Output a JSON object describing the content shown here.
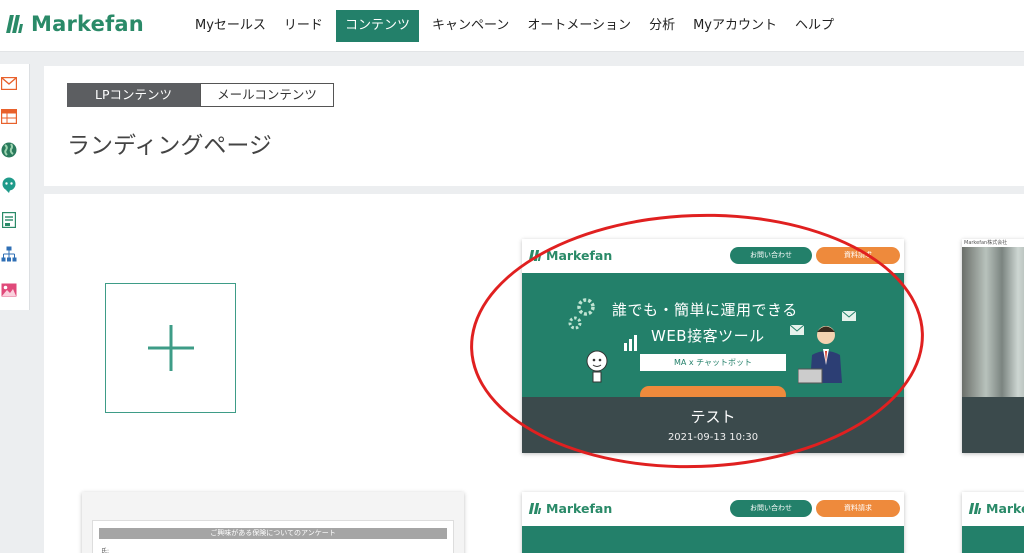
{
  "app": {
    "logo_text": "Markefan",
    "brand_color": "#23806a",
    "accent_orange": "#ee8a3c"
  },
  "nav": {
    "items": [
      {
        "label": "Myセールス",
        "active": false
      },
      {
        "label": "リード",
        "active": false
      },
      {
        "label": "コンテンツ",
        "active": true
      },
      {
        "label": "キャンペーン",
        "active": false
      },
      {
        "label": "オートメーション",
        "active": false
      },
      {
        "label": "分析",
        "active": false
      },
      {
        "label": "Myアカウント",
        "active": false
      },
      {
        "label": "ヘルプ",
        "active": false
      }
    ]
  },
  "rail": {
    "icons": [
      "mail-icon",
      "table-icon",
      "globe-icon",
      "chatbot-icon",
      "form-icon",
      "sitemap-icon",
      "image-icon"
    ]
  },
  "content_tabs": {
    "lp": "LPコンテンツ",
    "mail": "メールコンテンツ",
    "active": "lp"
  },
  "page": {
    "title": "ランディングページ"
  },
  "cards": {
    "add_icon": "plus-icon",
    "featured": {
      "logo_text": "Markefan",
      "btn_contact": "お問い合わせ",
      "btn_docs": "資料請求",
      "hero_line1": "誰でも・簡単に運用できる",
      "hero_line2": "WEB接客ツール",
      "hero_pill": "MA x チャットボット",
      "overlay_title": "テスト",
      "overlay_date": "2021-09-13 10:30"
    },
    "photo_card": {
      "caption": "Markefan株式会社"
    },
    "bottom_left": {
      "survey_title": "ご興味がある保険についてのアンケート",
      "first_label": "氏:"
    },
    "bottom_mid": {
      "logo_text": "Markefan",
      "btn_contact": "お問い合わせ",
      "btn_docs": "資料請求"
    },
    "bottom_right": {
      "logo_text": "Markef"
    }
  }
}
